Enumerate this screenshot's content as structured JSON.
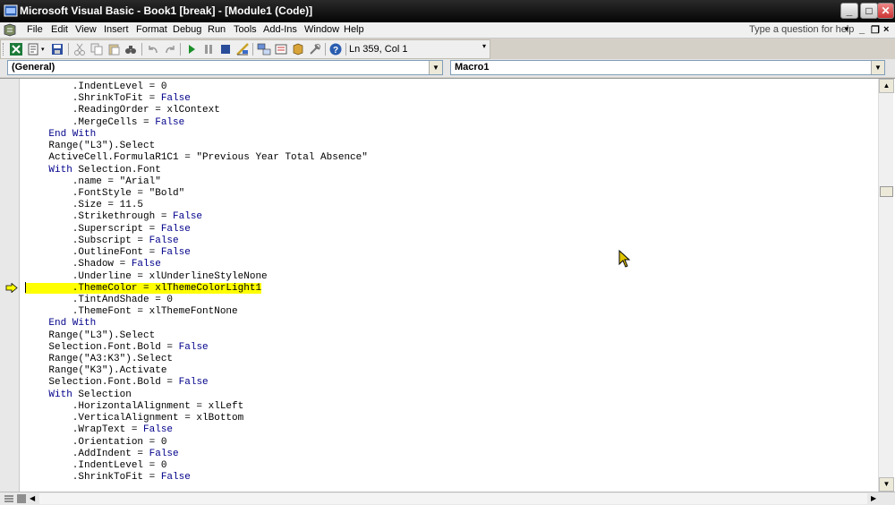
{
  "window": {
    "title": "Microsoft Visual Basic - Book1 [break] - [Module1 (Code)]",
    "minimize": "_",
    "maximize": "□",
    "close": "✕"
  },
  "menu": {
    "items": [
      "File",
      "Edit",
      "View",
      "Insert",
      "Format",
      "Debug",
      "Run",
      "Tools",
      "Add-Ins",
      "Window",
      "Help"
    ],
    "help_placeholder": "Type a question for help",
    "mdi_min": "_",
    "mdi_restore": "❐",
    "mdi_close": "×"
  },
  "toolbar": {
    "icons": [
      "excel-icon",
      "insert-module-icon",
      "save-icon",
      "cut-icon",
      "copy-icon",
      "paste-icon",
      "find-icon",
      "undo-icon",
      "redo-icon",
      "run-icon",
      "break-icon",
      "reset-icon",
      "design-mode-icon",
      "project-explorer-icon",
      "properties-icon",
      "object-browser-icon",
      "toolbox-icon",
      "help-icon"
    ],
    "position": "Ln 359, Col 1"
  },
  "combos": {
    "object": "(General)",
    "procedure": "Macro1"
  },
  "code": {
    "lines": [
      {
        "text": "        .IndentLevel = 0"
      },
      {
        "text": "        .ShrinkToFit = False"
      },
      {
        "text": "        .ReadingOrder = xlContext"
      },
      {
        "text": "        .MergeCells = False"
      },
      {
        "text": "    End With"
      },
      {
        "text": "    Range(\"L3\").Select"
      },
      {
        "text": "    ActiveCell.FormulaR1C1 = \"Previous Year Total Absence\""
      },
      {
        "text": "    With Selection.Font"
      },
      {
        "text": "        .name = \"Arial\""
      },
      {
        "text": "        .FontStyle = \"Bold\""
      },
      {
        "text": "        .Size = 11.5"
      },
      {
        "text": "        .Strikethrough = False"
      },
      {
        "text": "        .Superscript = False"
      },
      {
        "text": "        .Subscript = False"
      },
      {
        "text": "        .OutlineFont = False"
      },
      {
        "text": "        .Shadow = False"
      },
      {
        "text": "        .Underline = xlUnderlineStyleNone"
      },
      {
        "text": "        .ThemeColor = xlThemeColorLight1",
        "highlight": true
      },
      {
        "text": "        .TintAndShade = 0"
      },
      {
        "text": "        .ThemeFont = xlThemeFontNone"
      },
      {
        "text": "    End With"
      },
      {
        "text": "    Range(\"L3\").Select"
      },
      {
        "text": "    Selection.Font.Bold = False"
      },
      {
        "text": "    Range(\"A3:K3\").Select"
      },
      {
        "text": "    Range(\"K3\").Activate"
      },
      {
        "text": "    Selection.Font.Bold = False"
      },
      {
        "text": "    With Selection"
      },
      {
        "text": "        .HorizontalAlignment = xlLeft"
      },
      {
        "text": "        .VerticalAlignment = xlBottom"
      },
      {
        "text": "        .WrapText = False"
      },
      {
        "text": "        .Orientation = 0"
      },
      {
        "text": "        .AddIndent = False"
      },
      {
        "text": "        .IndentLevel = 0"
      },
      {
        "text": "        .ShrinkToFit = False"
      }
    ],
    "keywords": [
      "End With",
      "With",
      "False",
      "True"
    ],
    "colors": {
      "keyword": "#00008b",
      "text": "#000000",
      "highlight": "#ffff00",
      "exec_arrow": "#ffff00"
    }
  }
}
